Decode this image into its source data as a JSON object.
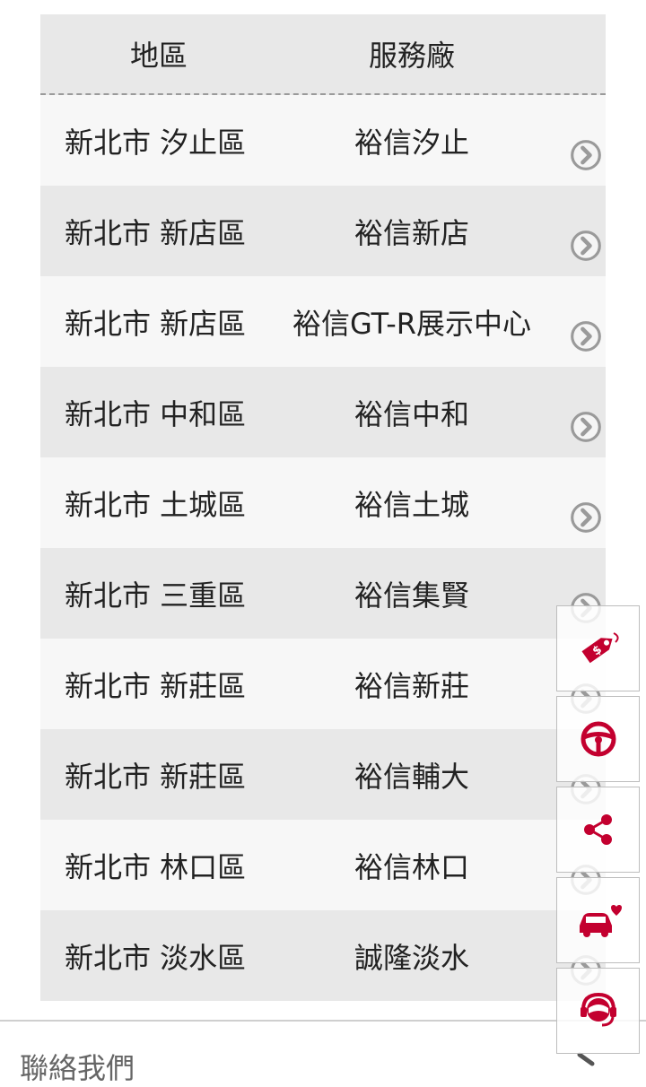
{
  "table": {
    "header": {
      "region": "地區",
      "service_center": "服務廠"
    },
    "rows": [
      {
        "region": "新北市 汐止區",
        "service_center": "裕信汐止"
      },
      {
        "region": "新北市 新店區",
        "service_center": "裕信新店"
      },
      {
        "region": "新北市 新店區",
        "service_center": "裕信GT-R展示中心"
      },
      {
        "region": "新北市 中和區",
        "service_center": "裕信中和"
      },
      {
        "region": "新北市 土城區",
        "service_center": "裕信土城"
      },
      {
        "region": "新北市 三重區",
        "service_center": "裕信集賢"
      },
      {
        "region": "新北市 新莊區",
        "service_center": "裕信新莊"
      },
      {
        "region": "新北市 新莊區",
        "service_center": "裕信輔大"
      },
      {
        "region": "新北市 林口區",
        "service_center": "裕信林口"
      },
      {
        "region": "新北市 淡水區",
        "service_center": "誠隆淡水"
      }
    ],
    "row_icon": "chevron-circle-right-icon"
  },
  "footer": {
    "contact_label": "聯絡我們",
    "icon": "chevron-right-icon"
  },
  "floating_menu": {
    "accent_color": "#c3002f",
    "items": [
      {
        "icon": "price-tag-icon"
      },
      {
        "icon": "steering-wheel-icon"
      },
      {
        "icon": "share-icon"
      },
      {
        "icon": "car-heart-icon"
      },
      {
        "icon": "customer-service-headset-icon"
      }
    ]
  }
}
